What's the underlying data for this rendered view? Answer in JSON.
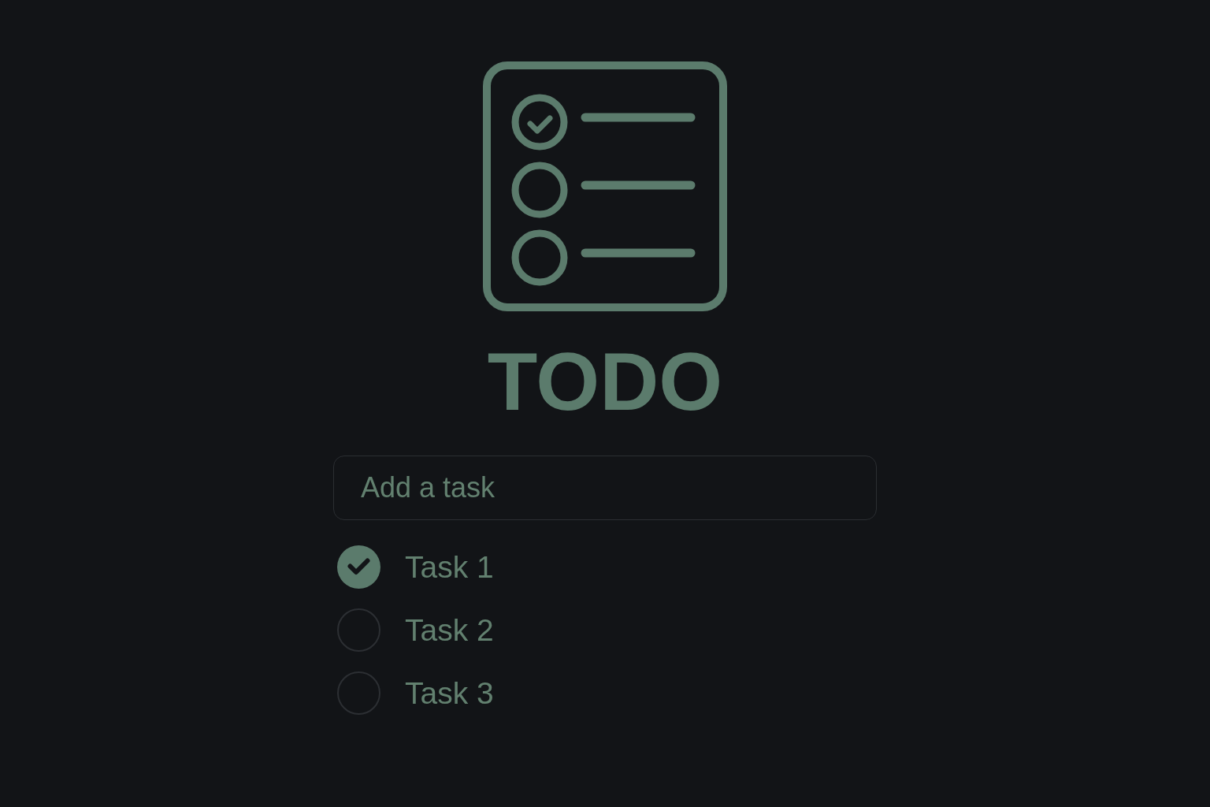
{
  "app": {
    "title": "TODO"
  },
  "new_task": {
    "placeholder": "Add a task"
  },
  "tasks": [
    {
      "label": "Task 1",
      "checked": true
    },
    {
      "label": "Task 2",
      "checked": false
    },
    {
      "label": "Task 3",
      "checked": false
    }
  ]
}
